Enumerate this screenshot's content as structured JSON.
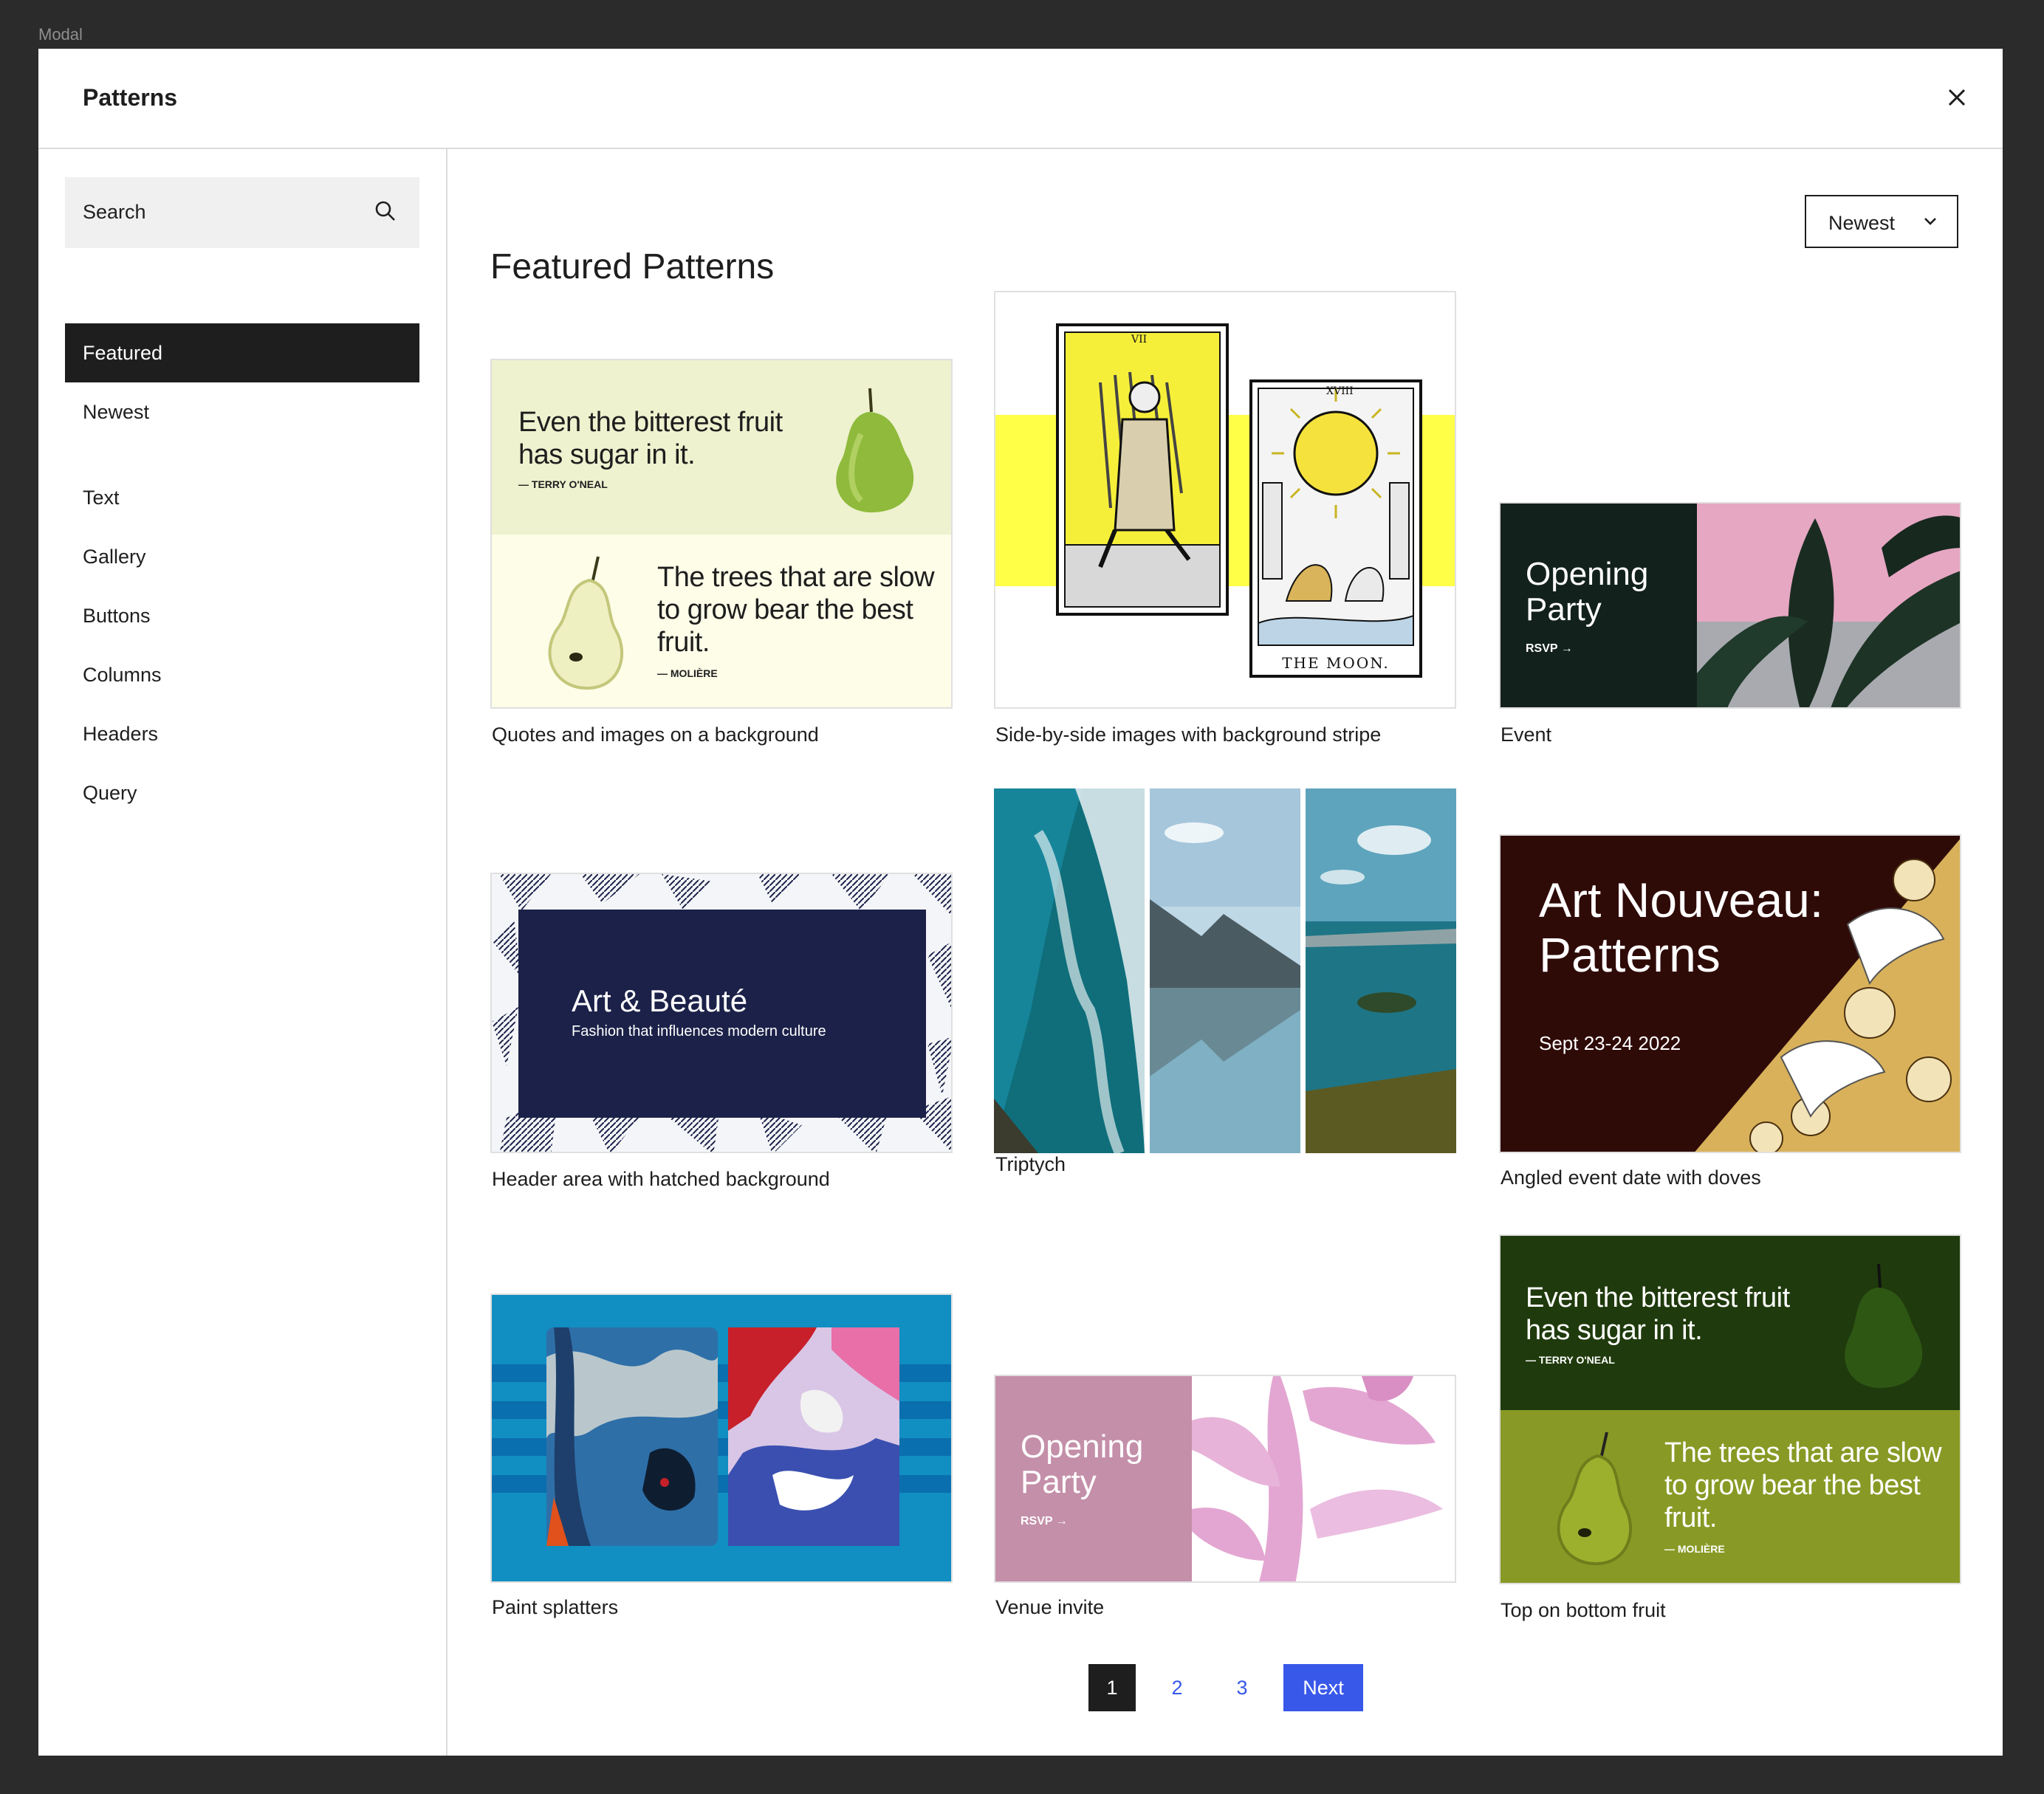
{
  "frame_label": "Modal",
  "modal": {
    "title": "Patterns"
  },
  "search": {
    "placeholder": "Search"
  },
  "sidebar": {
    "items": [
      {
        "label": "Featured",
        "active": true
      },
      {
        "label": "Newest"
      },
      {
        "label": "Text"
      },
      {
        "label": "Gallery"
      },
      {
        "label": "Buttons"
      },
      {
        "label": "Columns"
      },
      {
        "label": "Headers"
      },
      {
        "label": "Query"
      }
    ]
  },
  "main": {
    "title": "Featured Patterns",
    "sort": "Newest",
    "patterns": [
      {
        "caption": "Quotes and images on a background",
        "quote1": "Even the bitterest fruit has sugar in it.",
        "author1": "— TERRY O'NEAL",
        "quote2": "The trees that are slow to grow bear the best fruit.",
        "author2": "— MOLIÈRE"
      },
      {
        "caption": "Side-by-side images with background stripe",
        "card1_numeral": "VII",
        "card2_numeral": "XVIII",
        "card2_name": "THE MOON."
      },
      {
        "caption": "Event",
        "title": "Opening Party",
        "rsvp": "RSVP →"
      },
      {
        "caption": "Header area with hatched background",
        "title": "Art & Beauté",
        "subtitle": "Fashion that influences modern culture"
      },
      {
        "caption": "Triptych"
      },
      {
        "caption": "Angled event date with doves",
        "title": "Art Nouveau: Patterns",
        "date": "Sept 23-24 2022"
      },
      {
        "caption": "Paint splatters"
      },
      {
        "caption": "Venue invite",
        "title": "Opening Party",
        "rsvp": "RSVP →"
      },
      {
        "caption": "Top on bottom fruit",
        "quote1": "Even the bitterest fruit has sugar in it.",
        "author1": "— TERRY O'NEAL",
        "quote2": "The trees that are slow to grow bear the best fruit.",
        "author2": "— MOLIÈRE"
      }
    ]
  },
  "pagination": {
    "pages": [
      "1",
      "2",
      "3"
    ],
    "current": "1",
    "next": "Next"
  },
  "colors": {
    "accent": "#3858e9",
    "dark": "#1e1e1e",
    "search_bg": "#f0f0f0",
    "pear_light": "#eef2cf",
    "pear_cream": "#fdfde8",
    "tarot_yellow": "#ffff47",
    "event_green": "#13211c",
    "event_pink": "#e6a7c2",
    "navy": "#1b2148",
    "maroon": "#2f0b08",
    "paint_blue": "#118ec2",
    "venue_pink": "#c48fa9",
    "fruit_dark_green": "#1f3a0c",
    "fruit_olive": "#889a25"
  },
  "icons": [
    "close-icon",
    "search-icon",
    "chevron-down-icon",
    "arrow-right-icon"
  ]
}
